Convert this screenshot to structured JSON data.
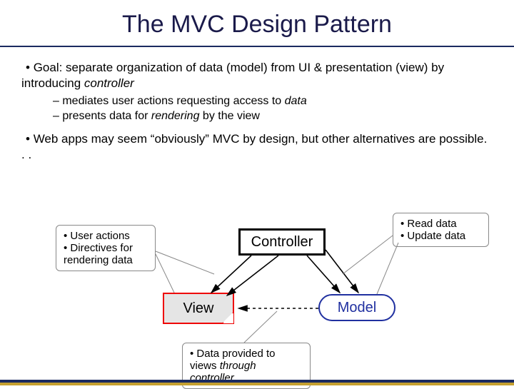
{
  "title": "The MVC Design Pattern",
  "bullets": {
    "goal_a": "Goal: separate organization of data (model) from UI & presentation (view) by introducing ",
    "goal_b": "controller",
    "sub1_a": "mediates user actions requesting access to ",
    "sub1_b": "data",
    "sub2_a": "presents data for ",
    "sub2_b": "rendering",
    "sub2_c": " by the view",
    "web": "Web apps may seem “obviously” MVC by design, but other alternatives are possible. . ."
  },
  "nodes": {
    "controller": "Controller",
    "view": "View",
    "model": "Model"
  },
  "callouts": {
    "ua1": "• User actions",
    "ua2": "• Directives for rendering data",
    "rd1": "• Read data",
    "rd2": "• Update data",
    "dp1": "• Data provided to views ",
    "dp2": "through controller"
  }
}
